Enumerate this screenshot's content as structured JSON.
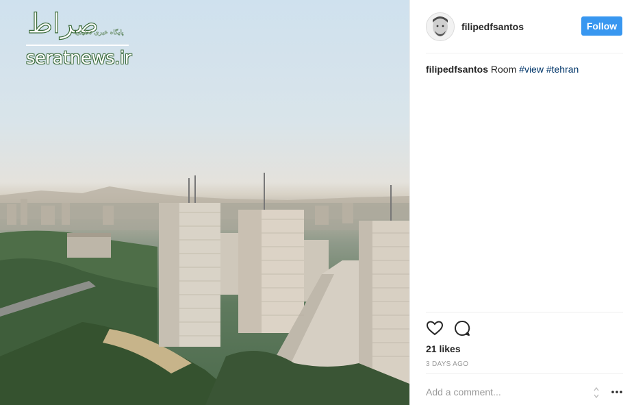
{
  "photo": {
    "watermark_logo_text": "صراط",
    "watermark_tagline": "پایگاه خبری تحلیلی",
    "watermark_site": "seratnews.ir"
  },
  "header": {
    "username": "filipedfsantos",
    "follow_label": "Follow"
  },
  "caption": {
    "username": "filipedfsantos",
    "text": "Room",
    "tags": [
      "#view",
      "#tehran"
    ]
  },
  "actions": {
    "like_icon": "heart-icon",
    "comment_icon": "comment-icon"
  },
  "likes_text": "21 likes",
  "time_ago": "3 DAYS AGO",
  "comment": {
    "placeholder": "Add a comment..."
  },
  "colors": {
    "follow_button": "#3897f0",
    "hashtag": "#003569",
    "muted": "#999999"
  }
}
